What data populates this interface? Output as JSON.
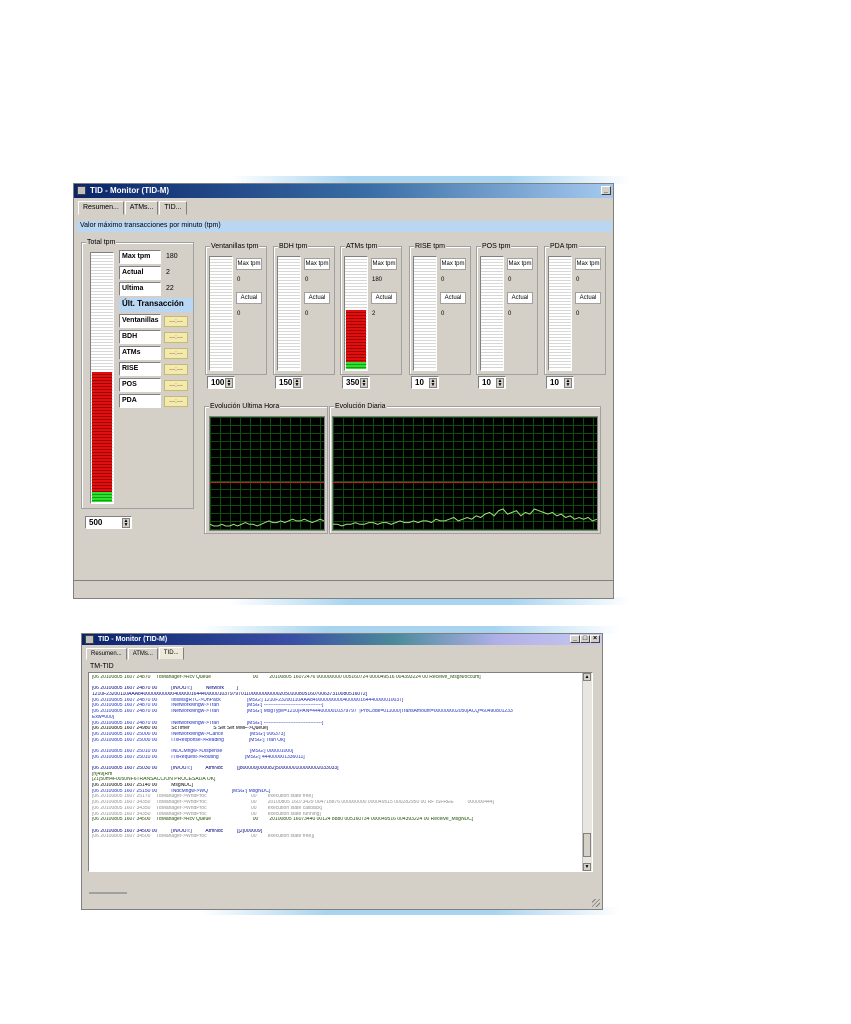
{
  "window1": {
    "title": "TID - Monitor (TID-M)",
    "tabs": [
      "Resumen...",
      "ATMs...",
      "TID..."
    ],
    "banner": "Valor máximo transacciones por minuto  (tpm)",
    "total_group_label": "Total tpm",
    "stats": [
      {
        "label": "Max tpm",
        "value": "180"
      },
      {
        "label": "Actual",
        "value": "2"
      },
      {
        "label": "Ultima",
        "value": "22"
      }
    ],
    "last_tx_label": "Últ. Transacción",
    "channels": [
      {
        "label": "Ventanillas",
        "value": "---:---"
      },
      {
        "label": "BDH",
        "value": "---:---"
      },
      {
        "label": "ATMs",
        "value": "---:---"
      },
      {
        "label": "RISE",
        "value": "---:---"
      },
      {
        "label": "POS",
        "value": "---:---"
      },
      {
        "label": "PDA",
        "value": "---:---"
      }
    ],
    "total_spin": "500",
    "meters": [
      {
        "label": "Ventanillas tpm",
        "max_label": "Max tpm",
        "max_value": "0",
        "actual_label": "Actual",
        "actual_value": "0",
        "spin": "100",
        "fill": 0
      },
      {
        "label": "BDH tpm",
        "max_label": "Max tpm",
        "max_value": "0",
        "actual_label": "Actual",
        "actual_value": "0",
        "spin": "150",
        "fill": 0
      },
      {
        "label": "ATMs tpm",
        "max_label": "Max tpm",
        "max_value": "180",
        "actual_label": "Actual",
        "actual_value": "2",
        "spin": "350",
        "fill": 0.52
      },
      {
        "label": "RISE tpm",
        "max_label": "Max tpm",
        "max_value": "0",
        "actual_label": "Actual",
        "actual_value": "0",
        "spin": "10",
        "fill": 0
      },
      {
        "label": "POS tpm",
        "max_label": "Max tpm",
        "max_value": "0",
        "actual_label": "Actual",
        "actual_value": "0",
        "spin": "10",
        "fill": 0
      },
      {
        "label": "PDA tpm",
        "max_label": "Max tpm",
        "max_value": "0",
        "actual_label": "Actual",
        "actual_value": "0",
        "spin": "10",
        "fill": 0
      }
    ],
    "total_fill": 0.52,
    "chart_hour_label": "Evolución Ultima Hora",
    "chart_day_label": "Evolución Diaria"
  },
  "window2": {
    "title": "TID - Monitor (TID-M)",
    "tabs": [
      "Resumen...",
      "ATMs...",
      "TID..."
    ],
    "section": "TM-TID",
    "log_lines": [
      {
        "t": "[06 20100805 1607 24870    TdManager->Rcv Queue                              00        20100805 16072476 000000000 005160724 000049516 004393224 00 Receive_MsgN/occum]",
        "c": "#205000"
      },
      {
        "t": "",
        "c": "#000"
      },
      {
        "t": "[06 20100805 1607 24870 00          [IN/OUT:]          Network         ]",
        "c": "#000080"
      },
      {
        "t": "1210F23200110AAA8400000000000400000164440000010379797011000000000002050100805160700637310080516072]",
        "c": "#000080"
      },
      {
        "t": "[06 20100805 1607 24870 00          IlosMsgRTC->UnPack                   [MSG:] 1210F23200110AAA840000000000400000164440000010037]",
        "c": "#2030c0"
      },
      {
        "t": "[06 20100805 1607 24870 00          INetworkMngw->Tran                    [MSG:] -----------------------------------]",
        "c": "#2030c0"
      },
      {
        "t": "[06 20100805 1607 24870 00          INetworkMngw->Tran                    [MSG:] MsgType=1210|PAN=4440000010379797  |ProCode=011000|TransAmount=000000002050|ACQ=60490801233",
        "c": "#2030c0"
      },
      {
        "t": "Exw=000]",
        "c": "#2030c0"
      },
      {
        "t": "[06 20100805 1607 24870 00          INetworkMngw->Tran                    [MSG:] -----------------------------------]",
        "c": "#2030c0"
      },
      {
        "t": "[06 20100805 1607 24980 00          ScTimer                 S Set Set MMF->Queue]",
        "c": "#000"
      },
      {
        "t": "[06 20100805 1607 25000 00          INetworkMngw->Cance                   [MSG:] 006373]",
        "c": "#2030c0"
      },
      {
        "t": "[06 20100805 1607 25000 00          ITxResponse->Reading                  [MSG:] Tran Ok]",
        "c": "#2030c0"
      },
      {
        "t": "",
        "c": "#000"
      },
      {
        "t": "[06 20100805 1607 25010 00          INDCMngw->Dispense                    [MSG:] 000001000]",
        "c": "#2030c0"
      },
      {
        "t": "[06 20100805 1607 25010 00          ITxRequest->Routing                   [MSG:] 444000001336011]",
        "c": "#2030c0"
      },
      {
        "t": "",
        "c": "#000"
      },
      {
        "t": "[06 20100805 1607 25030 00          [IN/OUT:]          AtmNdc          [[800000[000082]5000000100000002033033]",
        "c": "#000080"
      },
      {
        "t": "[h]49[Rm",
        "c": "#205000"
      },
      {
        "t": "[21]50m4F0050NF6TRANSACCION PROCESADA OK]",
        "c": "#205000"
      },
      {
        "t": "[06 20100805 1607 25140 00          MsgNDC]",
        "c": "#000"
      },
      {
        "t": "[06 20100805 1607 25150 00          INdcMngw->WQ                 [MSG:] MsgNDC]",
        "c": "#2030c0"
      },
      {
        "t": "[06 20100805 1607 25170    TdManager->WndProc                                00        execution state free]",
        "c": "#909090"
      },
      {
        "t": "[06 20100805 1607 34350    TdManager->WndProc                                00        20100805 16073429 004718876 000000000 000049515 000282950 00 RF ISFREE          000000444]",
        "c": "#909090"
      },
      {
        "t": "[06 20100805 1607 34350    TdManager->WndProc                                00        execution state callback]",
        "c": "#909090"
      },
      {
        "t": "[06 20100805 1607 34350    TdManager->WndProc                                00        execution state running]",
        "c": "#909090"
      },
      {
        "t": "[06 20100805 1607 34500    TdManager->Rcv Queue                              00        20100805 16073440 00124 8880 005160734 000049516 004393224 00 Receive_MsgNDC]",
        "c": "#205000"
      },
      {
        "t": "",
        "c": "#000"
      },
      {
        "t": "[06 20100805 1607 34500 00          [IN/OUT:]          AtmNdc          [[2]000009]",
        "c": "#000080"
      },
      {
        "t": "[06 20100805 1607 34500    TdManager->WndProc                                00        execution state free]]",
        "c": "#909090"
      }
    ]
  },
  "chart_hour_series": [
    1,
    0,
    0,
    1,
    0,
    0,
    1,
    0,
    1,
    2,
    1,
    1,
    0,
    1,
    2,
    3,
    2,
    2,
    3,
    2,
    3,
    4,
    3,
    3,
    4,
    3,
    2,
    3,
    4,
    3
  ],
  "chart_day_series": [
    1,
    1,
    0,
    1,
    1,
    2,
    1,
    1,
    2,
    2,
    1,
    2,
    2,
    1,
    2,
    3,
    2,
    2,
    3,
    2,
    3,
    3,
    2,
    4,
    3,
    3,
    4,
    5,
    3,
    4,
    5,
    4,
    6,
    5,
    7,
    8,
    6,
    9,
    10,
    7,
    8,
    9,
    6,
    8,
    7,
    10,
    9,
    8,
    7,
    8,
    6,
    7,
    5,
    6,
    4,
    5,
    4,
    5,
    3,
    4
  ]
}
